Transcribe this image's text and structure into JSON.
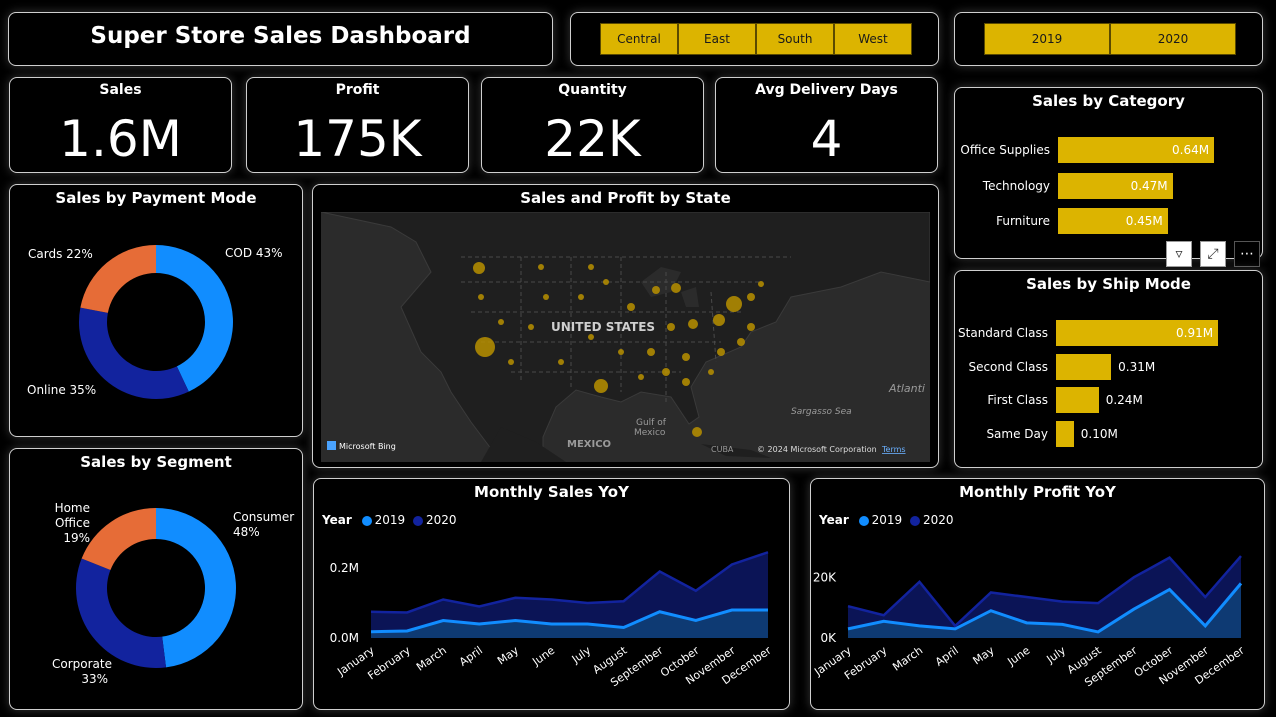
{
  "title": "Super Store Sales Dashboard",
  "region_slicer": [
    "Central",
    "East",
    "South",
    "West"
  ],
  "year_slicer": [
    "2019",
    "2020"
  ],
  "kpis": {
    "sales": {
      "label": "Sales",
      "value": "1.6M"
    },
    "profit": {
      "label": "Profit",
      "value": "175K"
    },
    "quantity": {
      "label": "Quantity",
      "value": "22K"
    },
    "delivery": {
      "label": "Avg Delivery Days",
      "value": "4"
    }
  },
  "payment": {
    "title": "Sales by Payment Mode",
    "labels": {
      "cod": "COD 43%",
      "cards": "Cards 22%",
      "online": "Online 35%"
    }
  },
  "segment": {
    "title": "Sales by Segment",
    "labels": {
      "consumer": "Consumer",
      "consumer_pct": "48%",
      "home": "Home Office",
      "home_pct": "19%",
      "corporate": "Corporate",
      "corporate_pct": "33%"
    }
  },
  "map": {
    "title": "Sales and Profit by State",
    "country_label": "UNITED STATES",
    "mexico_label": "MEXICO",
    "gulf_label_1": "Gulf of",
    "gulf_label_2": "Mexico",
    "cuba_label": "CUBA",
    "atlantic_label": "Atlanti",
    "sargasso_label": "Sargasso Sea",
    "bing_label": "Microsoft Bing",
    "copyright": "© 2024 Microsoft Corporation",
    "terms": "Terms"
  },
  "category": {
    "title": "Sales by Category"
  },
  "shipmode": {
    "title": "Sales by Ship Mode"
  },
  "monthly_sales": {
    "title": "Monthly Sales YoY",
    "legend_label": "Year"
  },
  "monthly_profit": {
    "title": "Monthly Profit YoY",
    "legend_label": "Year"
  },
  "colors": {
    "accent": "#dcb400",
    "blue_2019": "#118dff",
    "navy_2020": "#12239e",
    "orange": "#e66c37"
  },
  "chart_data": [
    {
      "type": "pie",
      "id": "payment",
      "title": "Sales by Payment Mode",
      "labels": [
        "COD",
        "Online",
        "Cards"
      ],
      "values": [
        43,
        35,
        22
      ],
      "colors": [
        "#118dff",
        "#12239e",
        "#e66c37"
      ]
    },
    {
      "type": "pie",
      "id": "segment",
      "title": "Sales by Segment",
      "labels": [
        "Consumer",
        "Corporate",
        "Home Office"
      ],
      "values": [
        48,
        33,
        19
      ],
      "colors": [
        "#118dff",
        "#12239e",
        "#e66c37"
      ]
    },
    {
      "type": "bar",
      "id": "category",
      "title": "Sales by Category",
      "categories": [
        "Office Supplies",
        "Technology",
        "Furniture"
      ],
      "values": [
        0.64,
        0.47,
        0.45
      ],
      "value_labels": [
        "0.64M",
        "0.47M",
        "0.45M"
      ]
    },
    {
      "type": "bar",
      "id": "shipmode",
      "title": "Sales by Ship Mode",
      "categories": [
        "Standard Class",
        "Second Class",
        "First Class",
        "Same Day"
      ],
      "values": [
        0.91,
        0.31,
        0.24,
        0.1
      ],
      "value_labels": [
        "0.91M",
        "0.31M",
        "0.24M",
        "0.10M"
      ]
    },
    {
      "type": "area",
      "id": "monthly_sales",
      "title": "Monthly Sales YoY",
      "x": [
        "January",
        "February",
        "March",
        "April",
        "May",
        "June",
        "July",
        "August",
        "September",
        "October",
        "November",
        "December"
      ],
      "series": [
        {
          "name": "2019",
          "values": [
            0.018,
            0.02,
            0.05,
            0.04,
            0.05,
            0.04,
            0.04,
            0.03,
            0.075,
            0.05,
            0.08,
            0.08
          ]
        },
        {
          "name": "2020",
          "values": [
            0.075,
            0.073,
            0.11,
            0.09,
            0.115,
            0.11,
            0.1,
            0.105,
            0.19,
            0.135,
            0.21,
            0.245
          ]
        }
      ],
      "ylim": [
        0,
        0.26
      ],
      "yticks": [
        "0.0M",
        "0.2M"
      ],
      "ytick_values": [
        0,
        0.2
      ]
    },
    {
      "type": "area",
      "id": "monthly_profit",
      "title": "Monthly Profit YoY",
      "x": [
        "January",
        "February",
        "March",
        "April",
        "May",
        "June",
        "July",
        "August",
        "September",
        "October",
        "November",
        "December"
      ],
      "series": [
        {
          "name": "2019",
          "values": [
            3000,
            5500,
            4000,
            3000,
            9000,
            5000,
            4500,
            2000,
            9500,
            16000,
            4000,
            18000
          ]
        },
        {
          "name": "2020",
          "values": [
            10500,
            7500,
            18500,
            4000,
            15000,
            13500,
            12000,
            11500,
            20000,
            26500,
            13500,
            27000
          ]
        }
      ],
      "ylim": [
        0,
        30000
      ],
      "yticks": [
        "0K",
        "20K"
      ],
      "ytick_values": [
        0,
        20000
      ]
    }
  ]
}
